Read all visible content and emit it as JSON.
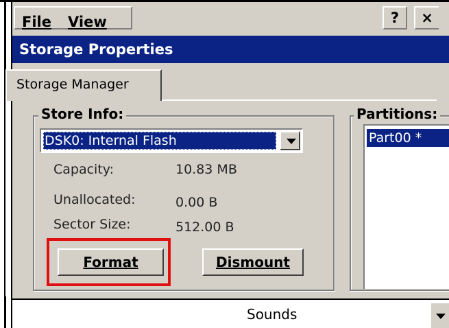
{
  "menu": {
    "file_label": "File",
    "view_label": "View",
    "help_label": "?",
    "close_label": "×"
  },
  "window": {
    "title": "Storage Properties"
  },
  "tabs": [
    {
      "label": "Storage Manager",
      "active": true
    }
  ],
  "store_info": {
    "group_label": "Store Info:",
    "selected_store": "DSK0: Internal Flash",
    "fields": [
      {
        "label": "Capacity:",
        "value": "10.83 MB"
      },
      {
        "label": "Unallocated:",
        "value": "0.00 B"
      },
      {
        "label": "Sector Size:",
        "value": "512.00 B"
      }
    ],
    "format_button": "Format",
    "dismount_button": "Dismount"
  },
  "partitions": {
    "group_label": "Partitions:",
    "items": [
      {
        "label": "Part00 *",
        "selected": true
      }
    ]
  },
  "bottom_bar": {
    "text": "Sounds"
  },
  "colors": {
    "titlebar": "#0a2385",
    "highlight_outline": "#e01010",
    "face": "#d4d0c8"
  }
}
